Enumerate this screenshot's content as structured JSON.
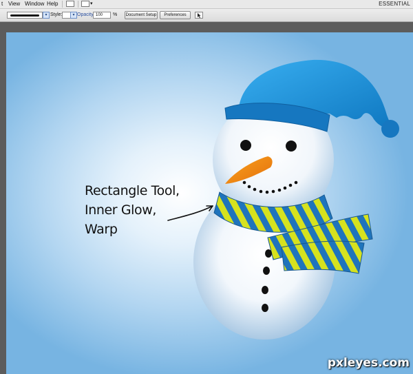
{
  "menu": {
    "items": [
      {
        "label": "t"
      },
      {
        "label": "View"
      },
      {
        "label": "Window"
      },
      {
        "label": "Help"
      }
    ],
    "workspace_label": "ESSENTIAL"
  },
  "control_bar": {
    "style_label": "Style:",
    "opacity_label": "Opacity:",
    "opacity_value": "100",
    "percent_label": "%",
    "document_setup_label": "Document Setup",
    "preferences_label": "Preferences",
    "dropdown_glyph": "▾"
  },
  "artwork": {
    "callout": [
      "Rectangle Tool,",
      "Inner Glow,",
      "Warp"
    ],
    "colors": {
      "sky": "#77b4e2",
      "hat": "#1c8fd4",
      "hat_band": "#1677c0",
      "carrot": "#f28a15",
      "scarf_blue": "#1f74bc",
      "scarf_yellow": "#d6e21e",
      "coal": "#111111"
    }
  },
  "watermark": "pxleyes.com"
}
